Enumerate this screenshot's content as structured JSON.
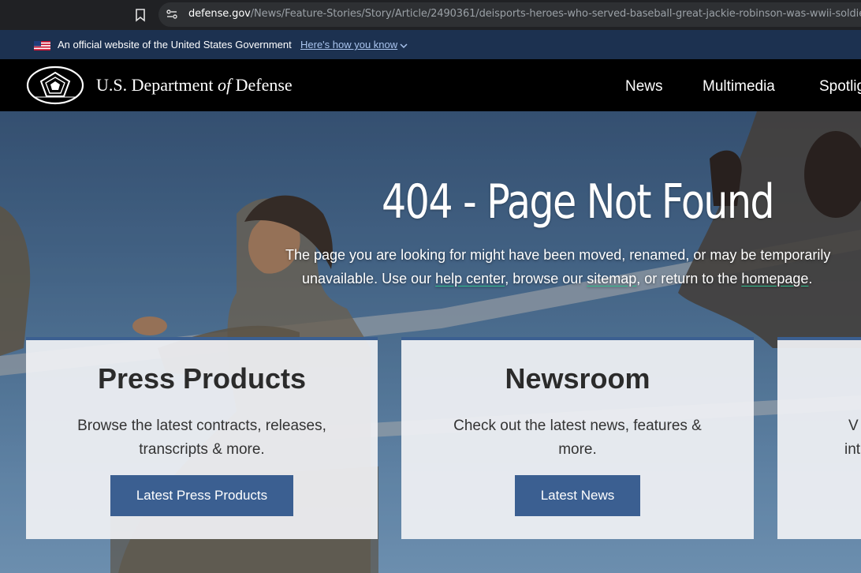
{
  "browser": {
    "url_host": "defense.gov",
    "url_path": "/News/Feature-Stories/Story/Article/2490361/deisports-heroes-who-served-baseball-great-jackie-robinson-was-wwii-soldier/"
  },
  "gov_banner": {
    "text": "An official website of the United States Government",
    "link": "Here's how you know"
  },
  "header": {
    "site_name_part1": "U.S. Department ",
    "site_name_of": "of",
    "site_name_part2": " Defense",
    "nav": [
      "News",
      "Multimedia",
      "Spotlig"
    ]
  },
  "hero": {
    "title": "404 - Page Not Found",
    "line1": "The page you are looking for might have been moved, renamed, or may be temporarily",
    "line2_a": "unavailable. Use our ",
    "link_help": "help center",
    "line2_b": ", browse our ",
    "link_sitemap": "sitemap",
    "line2_c": ", or return to the ",
    "link_home": "homepage",
    "line2_d": "."
  },
  "cards": [
    {
      "title": "Press Products",
      "desc_line1": "Browse the latest contracts, releases,",
      "desc_line2": "transcripts & more.",
      "button": "Latest Press Products"
    },
    {
      "title": "Newsroom",
      "desc_line1": "Check out the latest news, features &",
      "desc_line2": "more.",
      "button": "Latest News"
    },
    {
      "title": "",
      "desc_line1": "V",
      "desc_line2": "int",
      "button": ""
    }
  ],
  "colors": {
    "accent": "#3b5f91",
    "gov_banner_bg": "#1c3150",
    "header_bg": "#000000",
    "link_underline": "#2fbf8f"
  }
}
